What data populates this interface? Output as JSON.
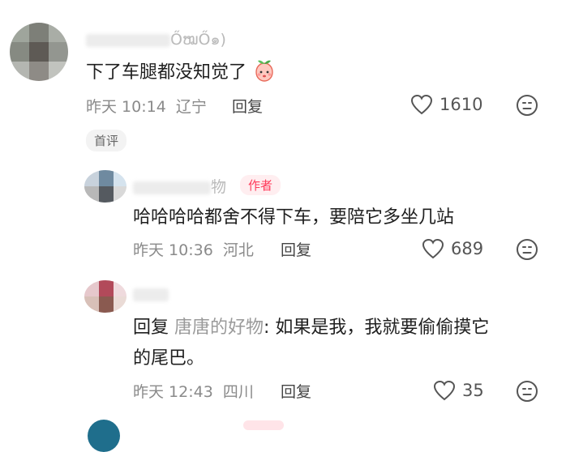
{
  "comment_main": {
    "username_visible": "ŐໝŐ๑)",
    "text": "下了车腿都没知觉了",
    "time": "昨天 10:14",
    "location": "辽宁",
    "reply_label": "回复",
    "likes": "1610",
    "tag_label": "首评"
  },
  "reply_1": {
    "username_visible": "物",
    "author_label": "作者",
    "text": "哈哈哈哈都舍不得下车，要陪它多坐几站",
    "time": "昨天 10:36",
    "location": "河北",
    "reply_label": "回复",
    "likes": "689"
  },
  "reply_2": {
    "reply_prefix": "回复",
    "reply_to": "唐唐的好物",
    "text_line1": ": 如果是我，我就要偷偷摸它",
    "text_line2": "的尾巴。",
    "time": "昨天 12:43",
    "location": "四川",
    "reply_label": "回复",
    "likes": "35"
  },
  "colors": {
    "author_tag_text": "#ff3a5a",
    "author_tag_bg": "#ffeef0",
    "meta_text": "#8a8a8a"
  },
  "icons": [
    "heart-icon",
    "emoji-reaction-icon",
    "peach-emoji-icon"
  ]
}
